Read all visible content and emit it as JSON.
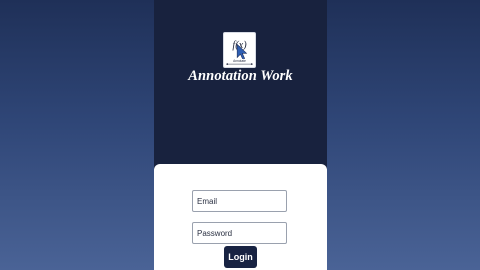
{
  "app": {
    "title": "Annotation Work",
    "logo_text": "f(x)",
    "logo_caption": "Annotate",
    "logo_icon": "cursor-pointer-icon"
  },
  "login_form": {
    "email_placeholder": "Email",
    "password_placeholder": "Password",
    "login_label": "Login"
  },
  "colors": {
    "background_top": "#1f3058",
    "background_bottom": "#4a6396",
    "panel": "#18223e",
    "card": "#ffffff",
    "button": "#182342",
    "cursor_accent": "#2f5fb3"
  }
}
